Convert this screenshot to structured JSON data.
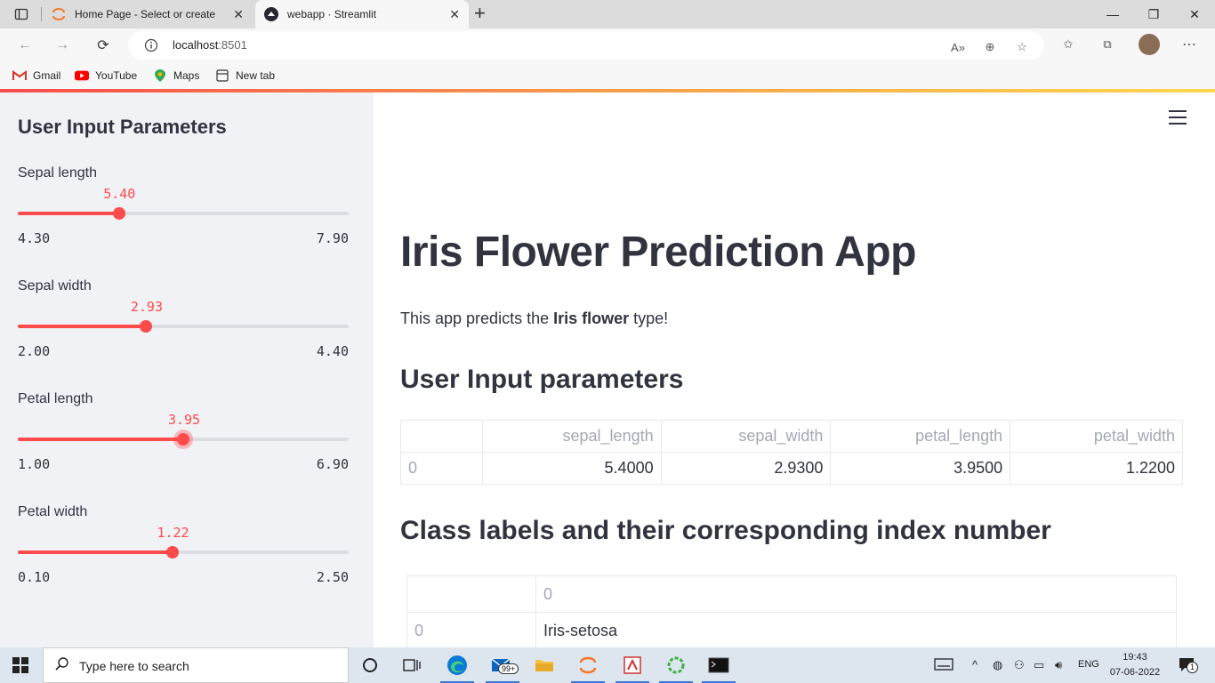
{
  "browser": {
    "tabs": [
      {
        "title": "Home Page - Select or create a n",
        "icon": "jupyter-icon"
      },
      {
        "title": "webapp · Streamlit",
        "icon": "streamlit-icon"
      }
    ],
    "url_host": "localhost",
    "url_port": ":8501",
    "bookmarks": [
      {
        "label": "Gmail",
        "icon": "gmail-icon"
      },
      {
        "label": "YouTube",
        "icon": "youtube-icon"
      },
      {
        "label": "Maps",
        "icon": "maps-icon"
      },
      {
        "label": "New tab",
        "icon": "new-tab-icon"
      }
    ]
  },
  "sidebar": {
    "title": "User Input Parameters",
    "sliders": [
      {
        "label": "Sepal length",
        "value": "5.40",
        "min": "4.30",
        "max": "7.90",
        "fraction": 0.3056
      },
      {
        "label": "Sepal width",
        "value": "2.93",
        "min": "2.00",
        "max": "4.40",
        "fraction": 0.3875
      },
      {
        "label": "Petal length",
        "value": "3.95",
        "min": "1.00",
        "max": "6.90",
        "fraction": 0.5
      },
      {
        "label": "Petal width",
        "value": "1.22",
        "min": "0.10",
        "max": "2.50",
        "fraction": 0.4667
      }
    ]
  },
  "main": {
    "title": "Iris Flower Prediction App",
    "intro_before": "This app predicts the ",
    "intro_bold": "Iris flower",
    "intro_after": " type!",
    "section1": "User Input parameters",
    "params_table": {
      "columns": [
        "",
        "sepal_length",
        "sepal_width",
        "petal_length",
        "petal_width"
      ],
      "rows": [
        [
          "0",
          "5.4000",
          "2.9300",
          "3.9500",
          "1.2200"
        ]
      ]
    },
    "section2": "Class labels and their corresponding index number",
    "labels_table": {
      "columns": [
        "",
        "0"
      ],
      "rows": [
        [
          "0",
          "Iris-setosa"
        ]
      ]
    }
  },
  "taskbar": {
    "search_placeholder": "Type here to search",
    "mail_badge": "99+",
    "language": "ENG",
    "time": "19:43",
    "date": "07-06-2022",
    "notification_count": "1"
  },
  "colors": {
    "accent": "#ff4b4b",
    "sidebar_bg": "#f0f2f6",
    "text": "#31333f"
  }
}
